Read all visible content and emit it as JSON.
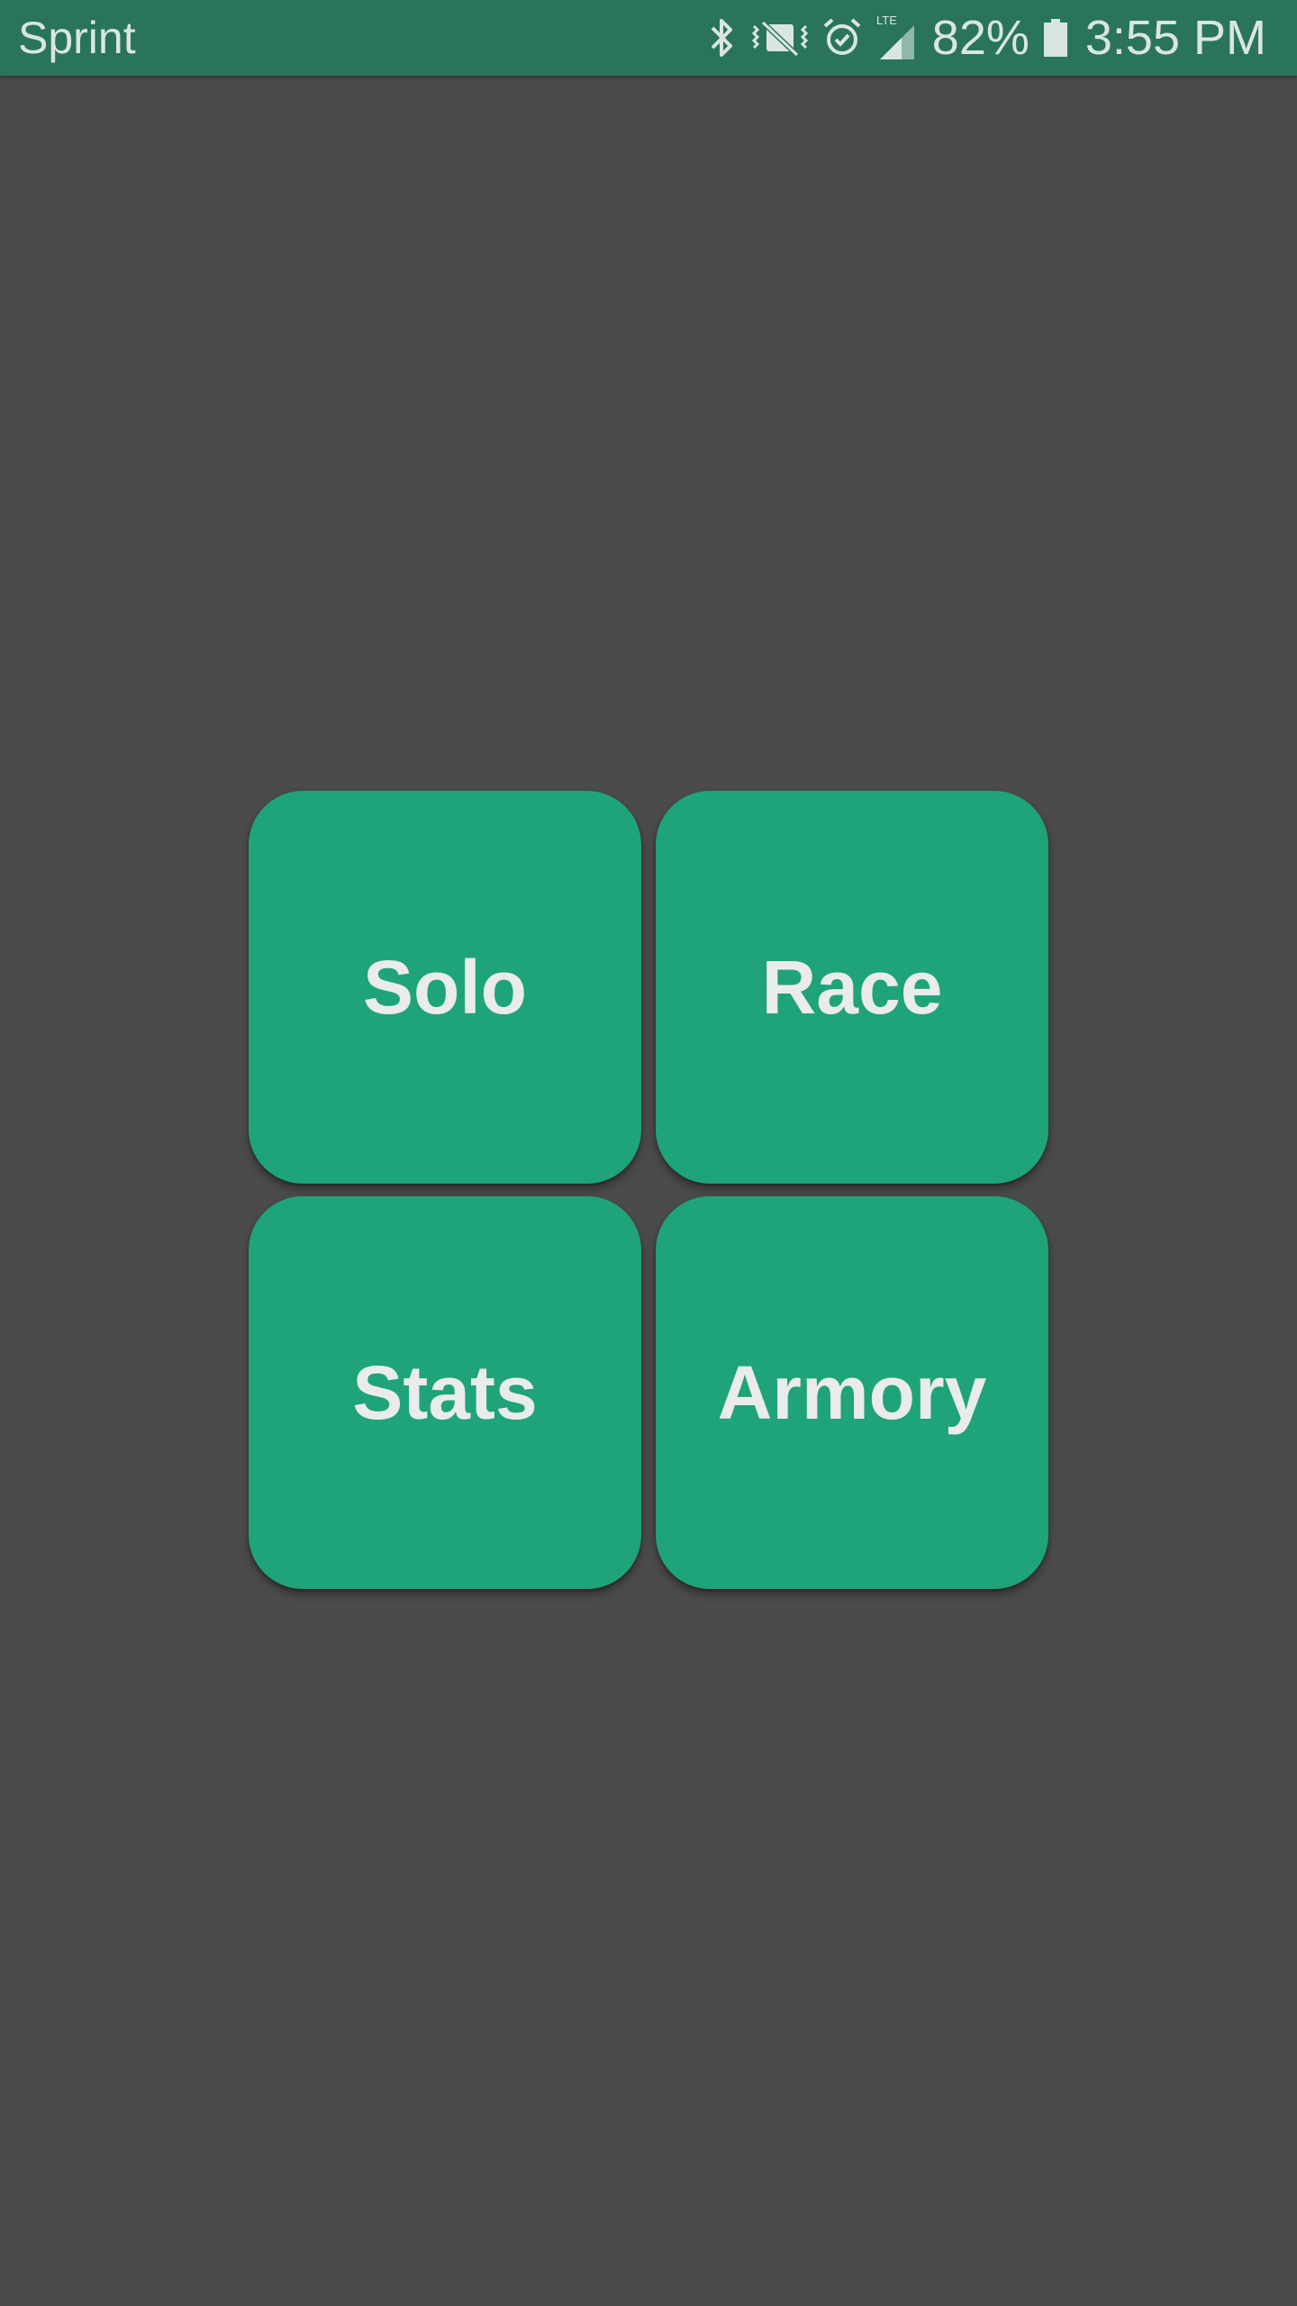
{
  "status_bar": {
    "carrier": "Sprint",
    "icons": [
      "bluetooth-icon",
      "vibrate-icon",
      "alarm-icon",
      "lte-signal-icon",
      "battery-icon"
    ],
    "network_label": "LTE",
    "battery_percent": "82%",
    "time": "3:55 PM",
    "background_color": "#2a745c"
  },
  "menu": {
    "solo_label": "Solo",
    "race_label": "Race",
    "stats_label": "Stats",
    "armory_label": "Armory",
    "tile_color": "#1fa37a"
  },
  "page": {
    "background_color": "#4b4b4b"
  }
}
